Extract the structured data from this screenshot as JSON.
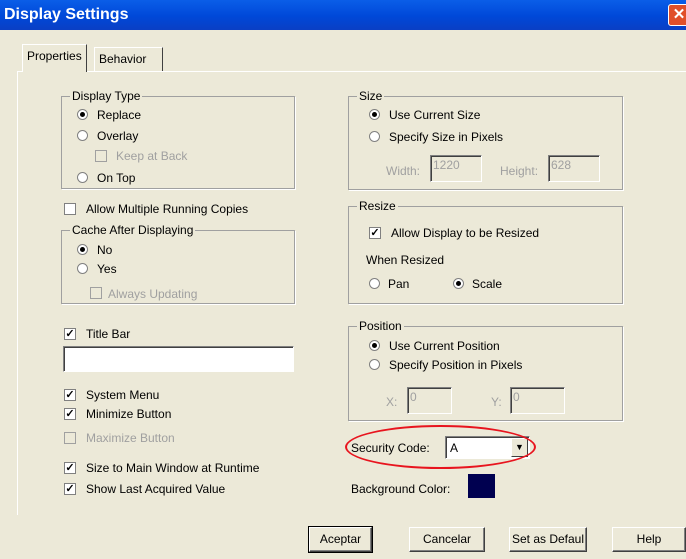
{
  "window": {
    "title": "Display Settings",
    "close_glyph": "✕"
  },
  "tabs": [
    {
      "label": "Properties",
      "active": true
    },
    {
      "label": "Behavior",
      "active": false
    }
  ],
  "display_type": {
    "title": "Display Type",
    "options": [
      {
        "label": "Replace",
        "checked": true
      },
      {
        "label": "Overlay",
        "checked": false
      },
      {
        "label": "On Top",
        "checked": false
      }
    ],
    "keep_at_back": {
      "label": "Keep at Back",
      "checked": false,
      "enabled": false
    }
  },
  "allow_multiple": {
    "label": "Allow Multiple Running Copies",
    "checked": false
  },
  "cache": {
    "title": "Cache After Displaying",
    "options": [
      {
        "label": "No",
        "checked": true
      },
      {
        "label": "Yes",
        "checked": false
      }
    ],
    "always_updating": {
      "label": "Always Updating",
      "checked": false,
      "enabled": false
    }
  },
  "title_bar": {
    "label": "Title Bar",
    "checked": true,
    "value": ""
  },
  "system_menu": {
    "label": "System Menu",
    "checked": true
  },
  "minimize_button": {
    "label": "Minimize Button",
    "checked": true
  },
  "maximize_button": {
    "label": "Maximize Button",
    "checked": false,
    "enabled": false
  },
  "size_to_main": {
    "label": "Size to Main Window at Runtime",
    "checked": true
  },
  "show_last": {
    "label": "Show Last Acquired Value",
    "checked": true
  },
  "size": {
    "title": "Size",
    "options": [
      {
        "label": "Use Current Size",
        "checked": true
      },
      {
        "label": "Specify Size in Pixels",
        "checked": false
      }
    ],
    "width_label": "Width:",
    "width_value": "1220",
    "height_label": "Height:",
    "height_value": "628"
  },
  "resize": {
    "title": "Resize",
    "allow": {
      "label": "Allow Display to be Resized",
      "checked": true
    },
    "when_resized": "When Resized",
    "options": [
      {
        "label": "Pan",
        "checked": false
      },
      {
        "label": "Scale",
        "checked": true
      }
    ]
  },
  "position": {
    "title": "Position",
    "options": [
      {
        "label": "Use Current Position",
        "checked": true
      },
      {
        "label": "Specify Position in Pixels",
        "checked": false
      }
    ],
    "x_label": "X:",
    "x_value": "0",
    "y_label": "Y:",
    "y_value": "0"
  },
  "security": {
    "label": "Security Code:",
    "value": "A",
    "dropdown_icon": "▼"
  },
  "background": {
    "label": "Background Color:",
    "color": "#000050"
  },
  "buttons": {
    "ok": "Aceptar",
    "cancel": "Cancelar",
    "set_default": "Set as Defaul",
    "help": "Help"
  },
  "colors": {
    "title_bar": "#0050e0",
    "annotation": "#e8141e"
  }
}
